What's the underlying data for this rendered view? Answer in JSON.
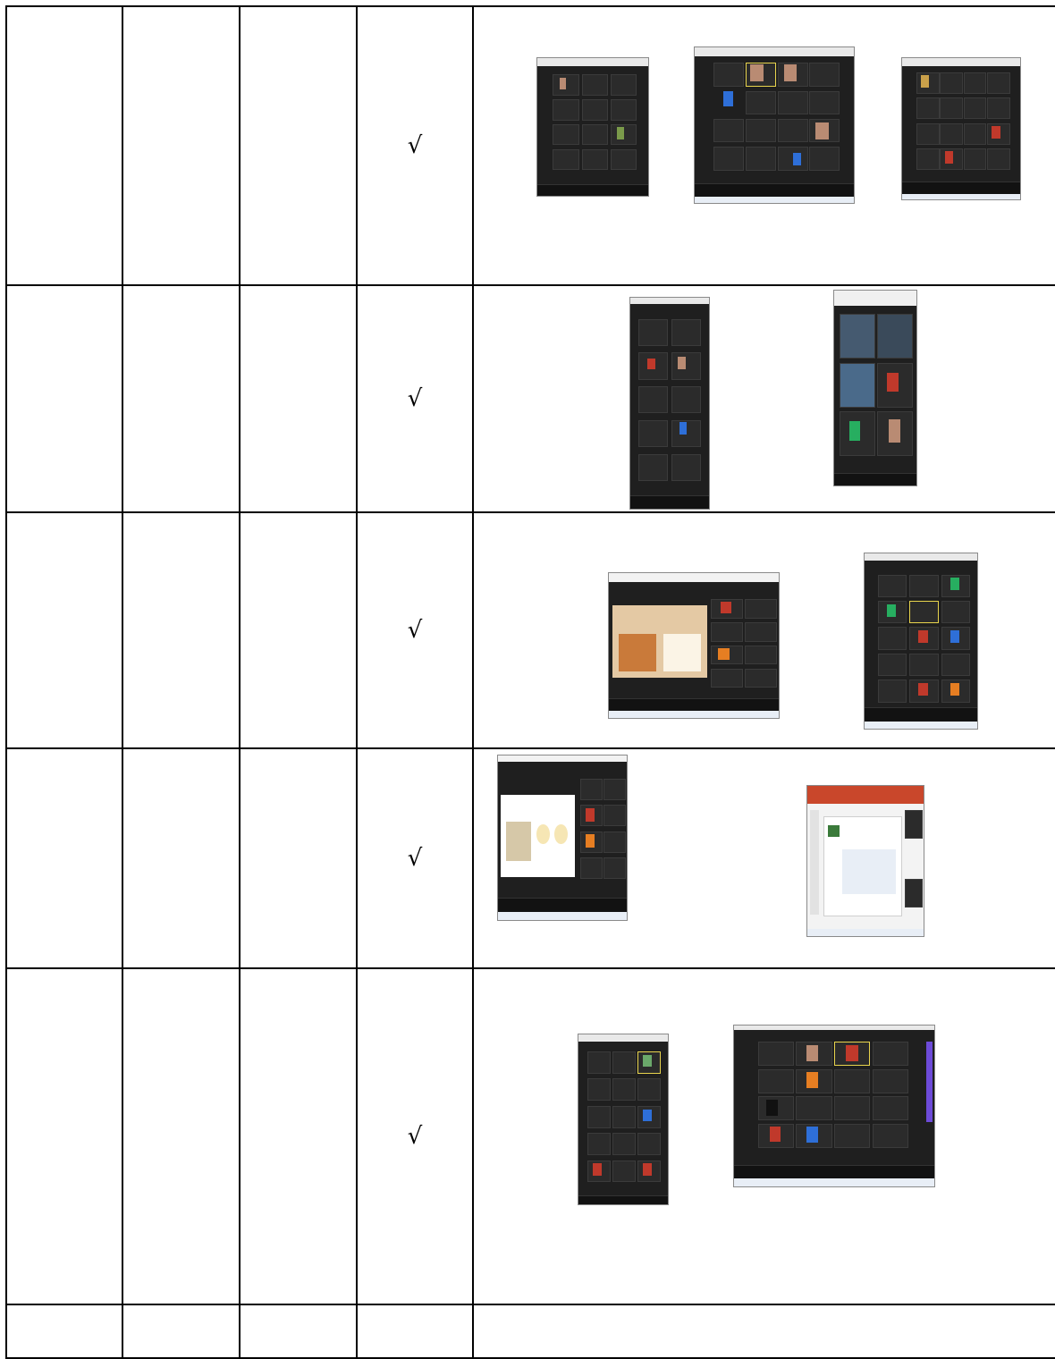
{
  "table": {
    "rows": [
      {
        "mark": "√",
        "screenshots": [
          "zoom-gallery-1",
          "zoom-gallery-2",
          "zoom-gallery-3"
        ]
      },
      {
        "mark": "√",
        "screenshots": [
          "zoom-mobile-1",
          "zoom-mobile-2"
        ]
      },
      {
        "mark": "√",
        "screenshots": [
          "zoom-share-slides-1",
          "zoom-gallery-4"
        ]
      },
      {
        "mark": "√",
        "screenshots": [
          "zoom-share-slides-2",
          "zoom-powerpoint-share"
        ]
      },
      {
        "mark": "√",
        "screenshots": [
          "zoom-mobile-3",
          "zoom-gallery-5"
        ]
      },
      {
        "mark": "",
        "screenshots": []
      }
    ]
  },
  "colors": {
    "border": "#000000",
    "zoom_dark": "#1f1f1f",
    "tile": "#2b2b2b",
    "avatar_red": "#c0392b",
    "avatar_orange": "#e67e22",
    "avatar_blue": "#2e6fd8",
    "avatar_green": "#27ae60"
  }
}
